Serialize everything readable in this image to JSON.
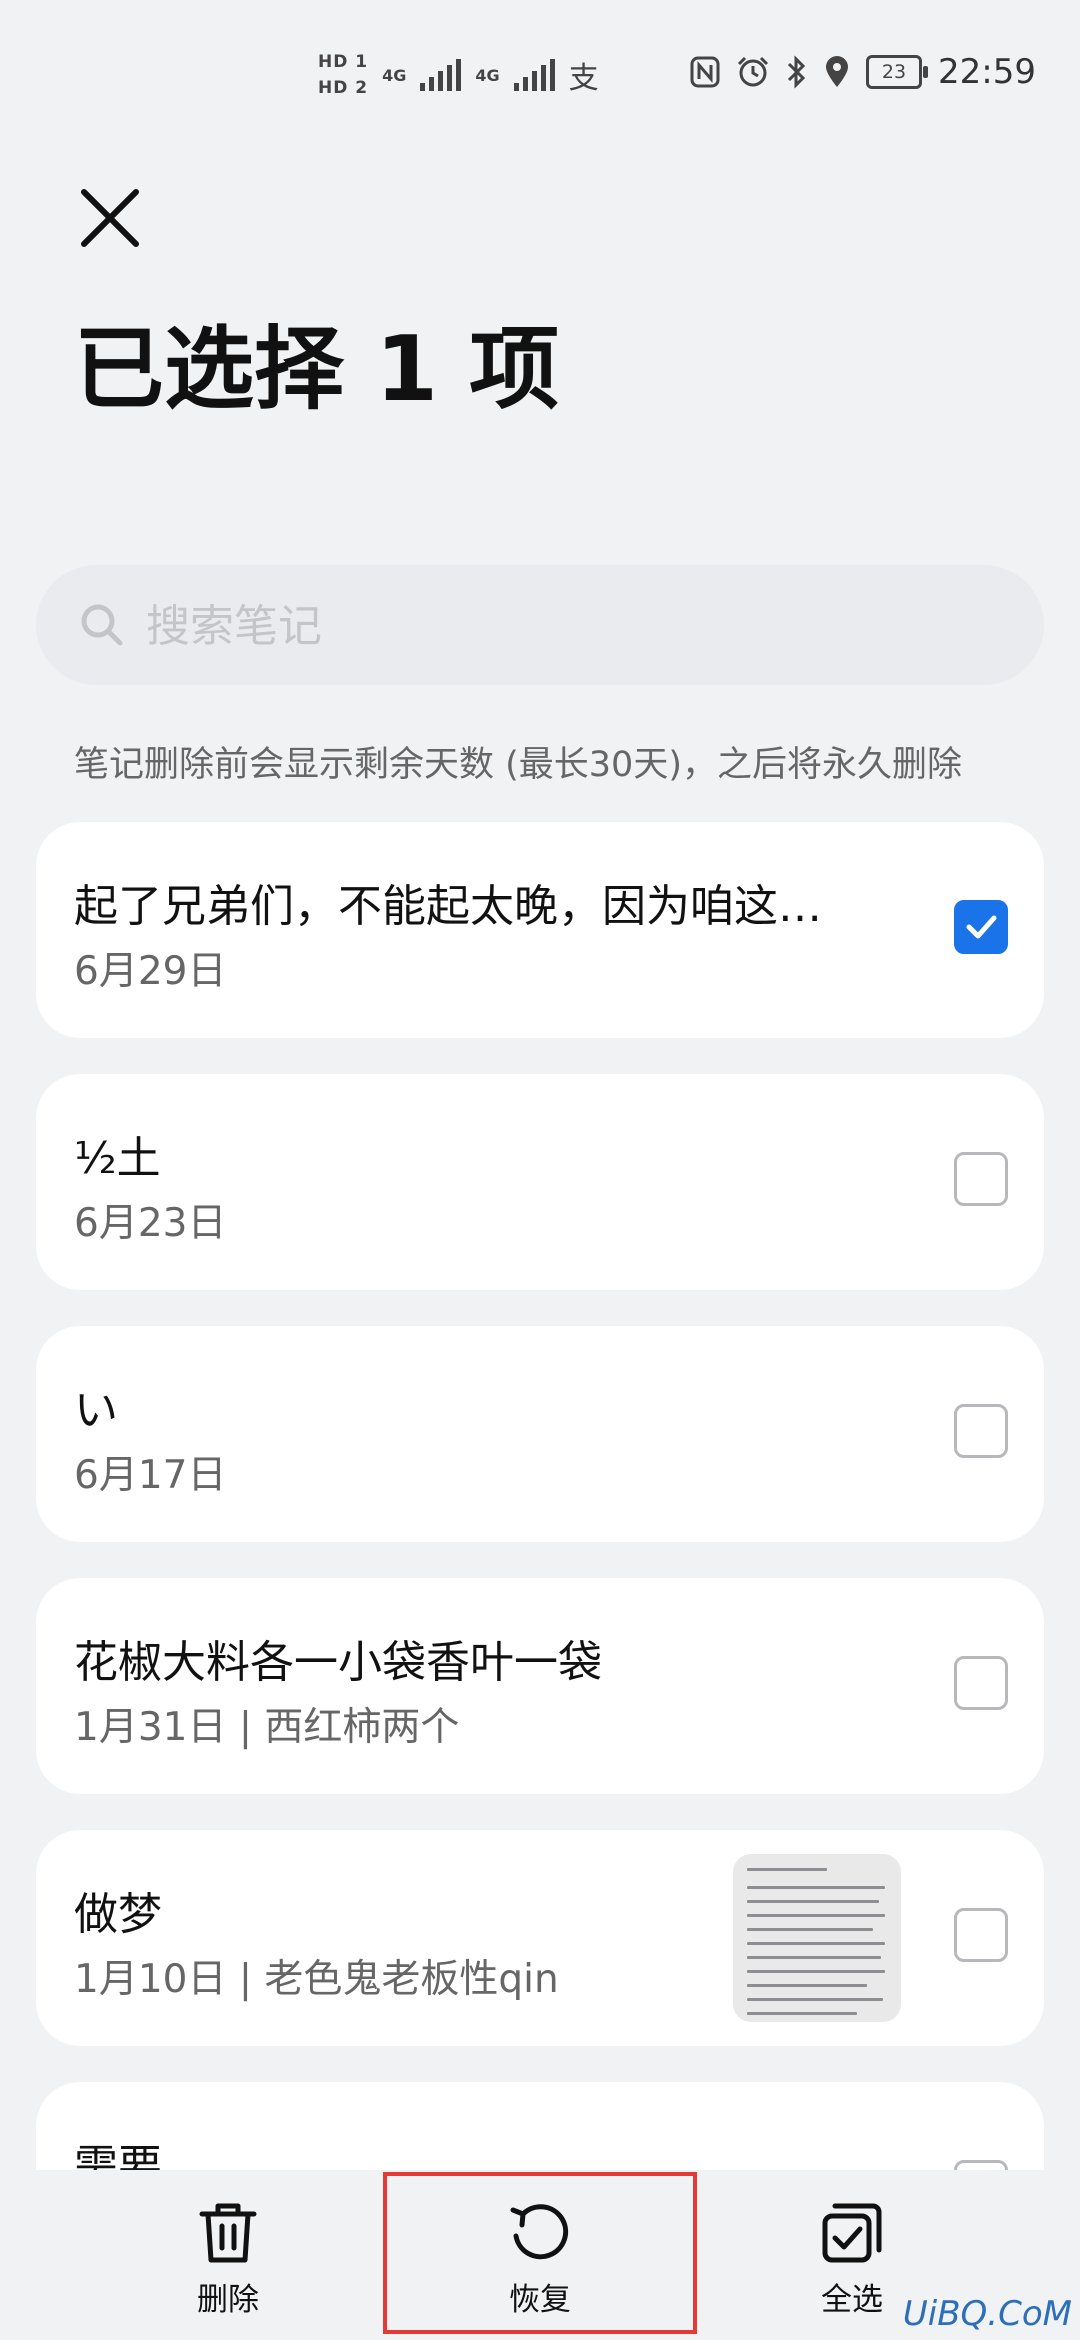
{
  "status_bar": {
    "sim1": "HD 1",
    "sim2": "HD 2",
    "net1": "4G",
    "net2": "4G",
    "app_icon_char": "支",
    "battery": "23",
    "time": "22:59",
    "icons": [
      "nfc-icon",
      "alarm-icon",
      "bluetooth-icon",
      "location-icon"
    ]
  },
  "header": {
    "close_icon": "close-icon",
    "title": "已选择 1 项"
  },
  "search": {
    "placeholder": "搜索笔记",
    "value": ""
  },
  "hint": "笔记删除前会显示剩余天数 (最长30天)，之后将永久删除",
  "notes": [
    {
      "title": "起了兄弟们，不能起太晚，因为咱这…",
      "subtitle": "6月29日",
      "checked": true
    },
    {
      "title": "½土",
      "subtitle": "6月23日",
      "checked": false
    },
    {
      "title": "い",
      "subtitle": "6月17日",
      "checked": false
    },
    {
      "title": "花椒大料各一小袋香叶一袋",
      "subtitle": "1月31日 | 西红柿两个",
      "checked": false
    },
    {
      "title": "做梦",
      "subtitle": "1月10日 | 老色鬼老板性qin",
      "checked": false,
      "has_thumbnail": true
    },
    {
      "title": "需要",
      "subtitle": "",
      "checked": false
    }
  ],
  "bottom_bar": {
    "delete_label": "删除",
    "restore_label": "恢复",
    "select_all_label": "全选"
  },
  "watermark": "UiBQ.CoM",
  "colors": {
    "accent": "#1a73e8",
    "background": "#f1f2f4",
    "highlight": "#e53935"
  }
}
